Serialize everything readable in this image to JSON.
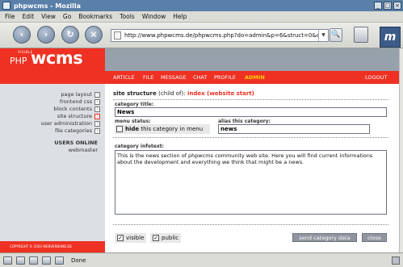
{
  "browser": {
    "window_title": "phpwcms - Mozilla",
    "menu": [
      "File",
      "Edit",
      "View",
      "Go",
      "Bookmarks",
      "Tools",
      "Window",
      "Help"
    ],
    "url": "http://www.phpwcms.de/phpwcms.php?do=admin&p=6&struct=0&cat=1",
    "status": "Done",
    "throbber_letter": "m"
  },
  "logo": {
    "small": "VISIBLE",
    "php": "PHP",
    "wcms": "wcms"
  },
  "topnav": {
    "items": [
      "ARTICLE",
      "FILE",
      "MESSAGE",
      "CHAT",
      "PROFILE",
      "ADMIN"
    ],
    "active": "ADMIN",
    "logout": "LOGOUT"
  },
  "sidebar": {
    "items": [
      "page layout",
      "frontend css",
      "block contents",
      "site structure",
      "user administration",
      "file categories"
    ],
    "active": "site structure",
    "users_online_title": "USERS ONLINE",
    "users_online": [
      "webmaster"
    ]
  },
  "footer": {
    "copyright": "COPYRIGHT © 2003 WEBVERBUND.DE"
  },
  "form": {
    "heading_prefix": "site structure",
    "heading_child": "(child of):",
    "heading_parent": "index (website start)",
    "category_title_label": "category title:",
    "category_title_value": "News",
    "menu_status_label": "menu status:",
    "hide_checked": false,
    "hide_bold": "hide",
    "hide_rest": "this category in menu",
    "alias_label": "alias this category:",
    "alias_value": "news",
    "infotext_label": "category infotext:",
    "infotext_value": "This is the news section of phpwcms community web site. Here you will find current informations about the development and everything we think that might be a news.",
    "visible_label": "visible",
    "visible_checked": true,
    "public_label": "public",
    "public_checked": true,
    "send_button": "send category data",
    "close_button": "close"
  },
  "colors": {
    "brand_red": "#ee3123",
    "active_yellow": "#ffd200",
    "band_grey": "#97a1ac",
    "sidebar_grey": "#dcdfe3"
  }
}
